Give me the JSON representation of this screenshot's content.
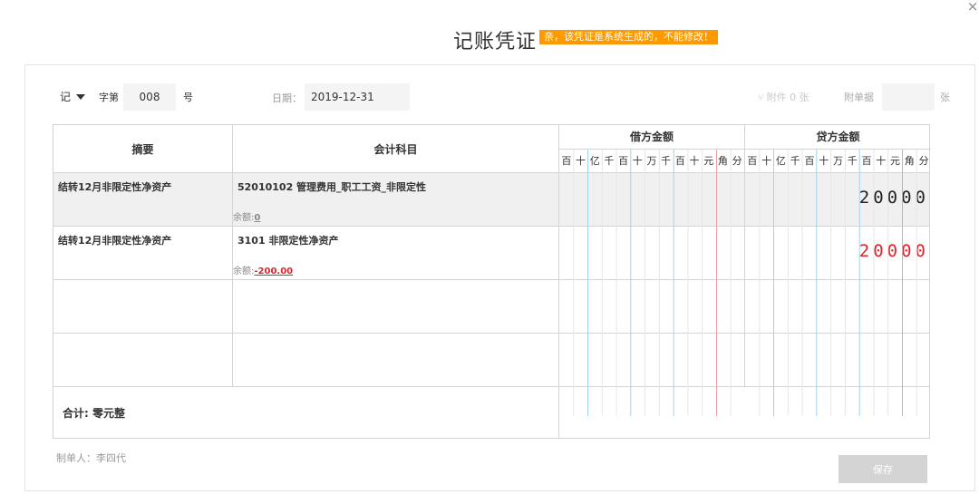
{
  "dialog": {
    "title": "记账凭证",
    "notice": "亲，该凭证是系统生成的，不能修改！",
    "close_symbol": "×"
  },
  "header": {
    "voucher_type": "记",
    "zi_label": "字第",
    "voucher_number": "008",
    "hao_label": "号",
    "date_label": "日期：",
    "date_value": "2019-12-31",
    "attachment_text": "附件 0 张",
    "attach_doc_label": "附单据",
    "attach_doc_count": "",
    "zhang_label": "张"
  },
  "table": {
    "col_summary": "摘要",
    "col_account": "会计科目",
    "col_debit": "借方金额",
    "col_credit": "贷方金额",
    "units": [
      "百",
      "十",
      "亿",
      "千",
      "百",
      "十",
      "万",
      "千",
      "百",
      "十",
      "元",
      "角",
      "分"
    ],
    "rows": [
      {
        "summary": "结转12月非限定性净资产",
        "account": "52010102 管理费用_职工工资_非限定性",
        "balance_label": "余额:",
        "balance_value": "0",
        "debit": "",
        "credit": "20000",
        "credit_color": "#222222"
      },
      {
        "summary": "结转12月非限定性净资产",
        "account": "3101 非限定性净资产",
        "balance_label": "余额:",
        "balance_value": "-200.00",
        "debit": "",
        "credit": "20000",
        "credit_color": "#e0242b"
      }
    ],
    "total_label": "合计:  零元整"
  },
  "footer": {
    "maker": "制单人：李四代",
    "save_label": "保存"
  },
  "colors": {
    "notice_bg": "#ff9900",
    "negative_red": "#e0242b",
    "unit_line": "#9fd3f0",
    "decimal_line": "#e9a0a0",
    "save_button_bg": "#d4d4d4"
  }
}
